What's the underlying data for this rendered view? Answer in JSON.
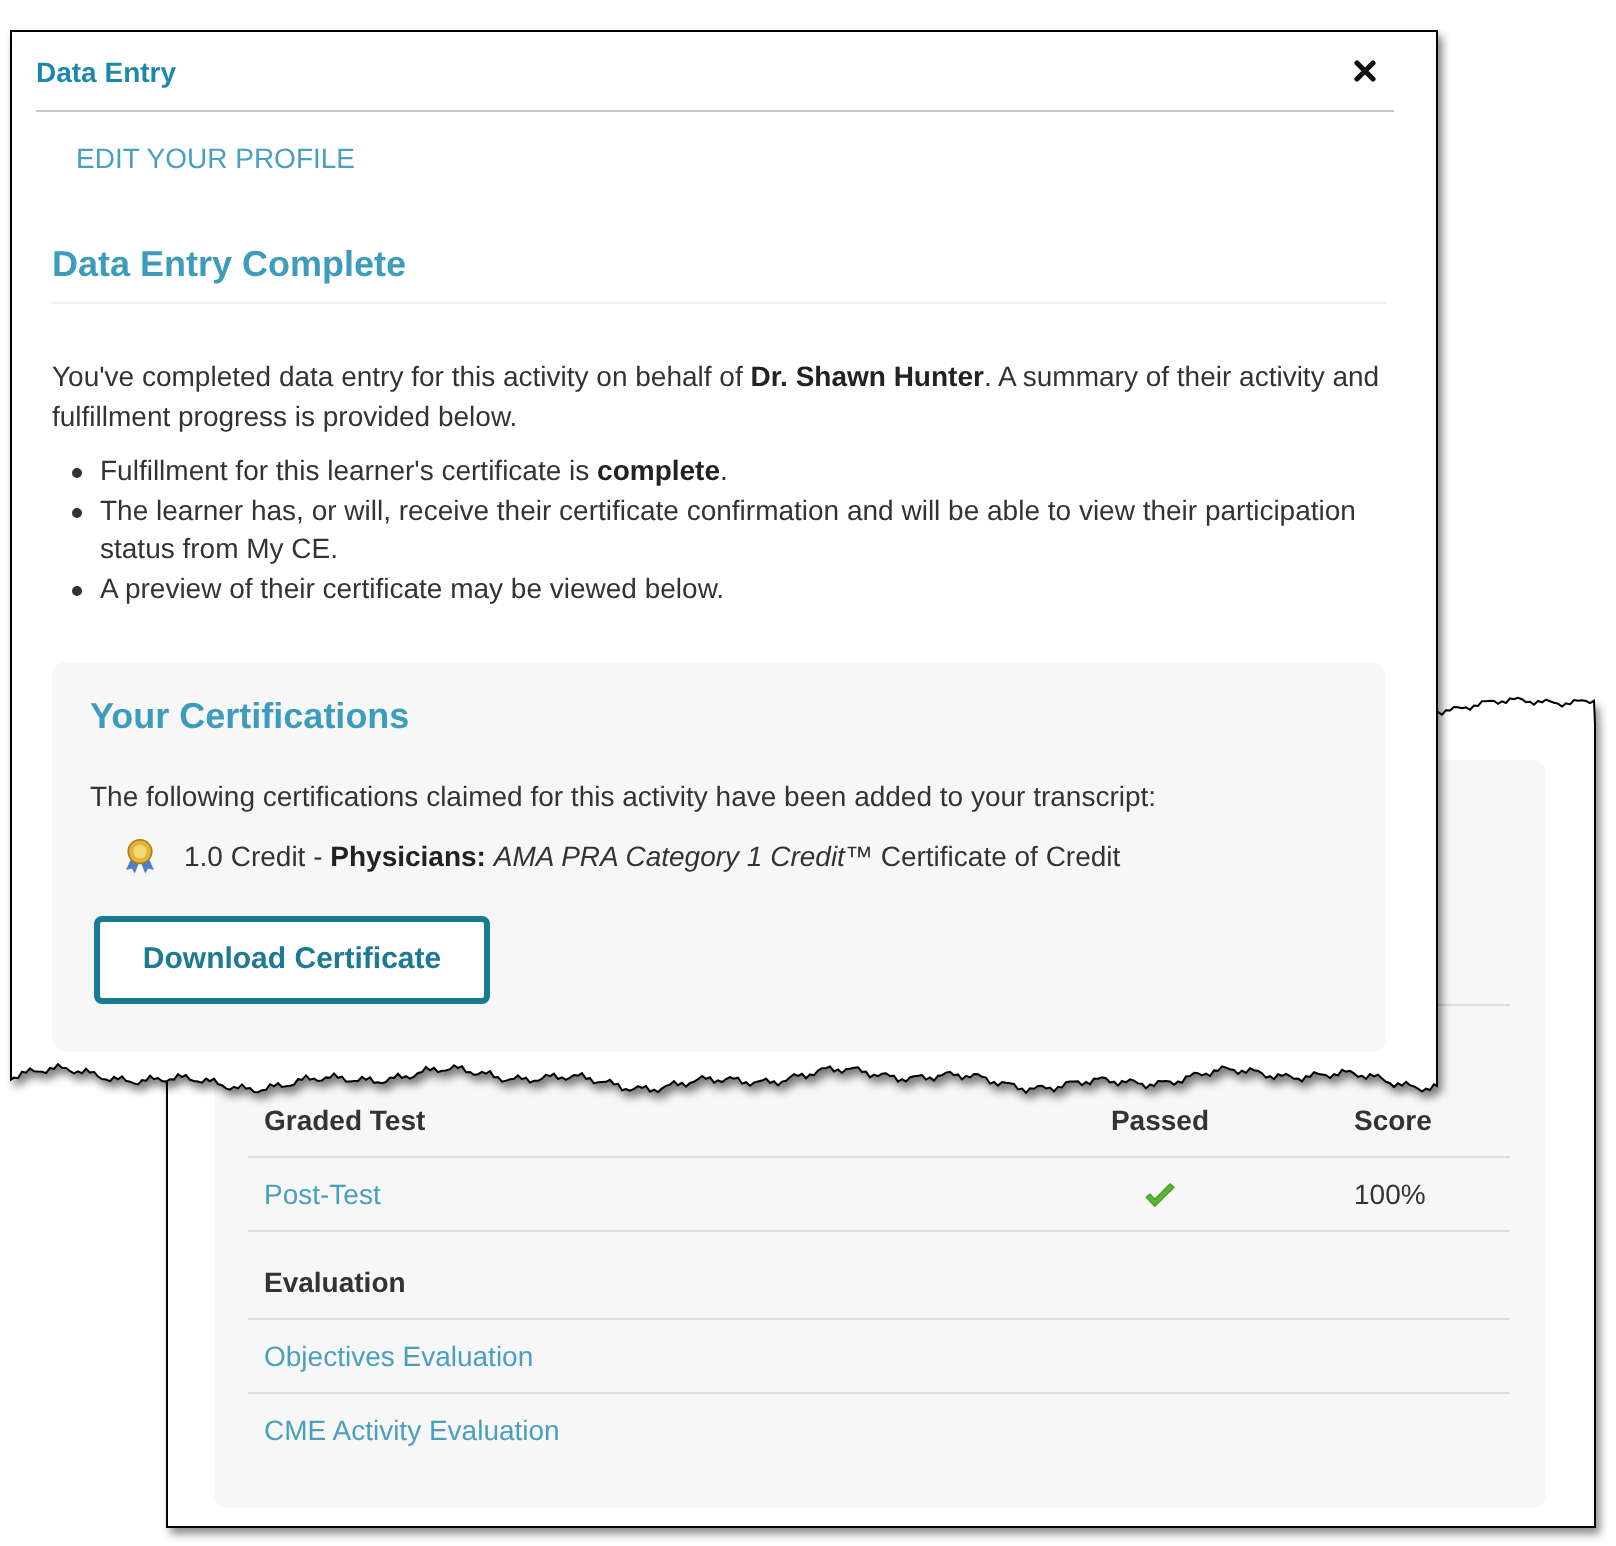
{
  "dialog": {
    "title": "Data Entry",
    "nav_link": "EDIT YOUR PROFILE",
    "heading": "Data Entry Complete",
    "intro": "You've completed data entry for this activity on behalf of **Dr. Shawn Hunter**. A summary of their activity and fulfillment progress is provided below.",
    "bullets": [
      "Fulfillment for this learner's certificate is **complete**.",
      "The learner has, or will, receive their certificate confirmation and will be able to view their participation status from My CE.",
      "A preview of their certificate may be viewed below."
    ],
    "certifications": {
      "title": "Your Certifications",
      "description": "The following certifications claimed for this activity have been added to your transcript:",
      "items": [
        {
          "text": "1.0 Credit - **Physicians:** *AMA PRA Category 1 Credit™* Certificate of Credit"
        }
      ],
      "button": "Download Certificate"
    }
  },
  "background_page": {
    "graded_tests": {
      "columns": [
        "Graded Test",
        "Passed",
        "Score"
      ],
      "rows": [
        {
          "name": "Post-Test",
          "passed": true,
          "score": "100%"
        }
      ]
    },
    "evaluation": {
      "heading": "Evaluation",
      "items": [
        "Objectives Evaluation",
        "CME Activity Evaluation"
      ]
    }
  }
}
